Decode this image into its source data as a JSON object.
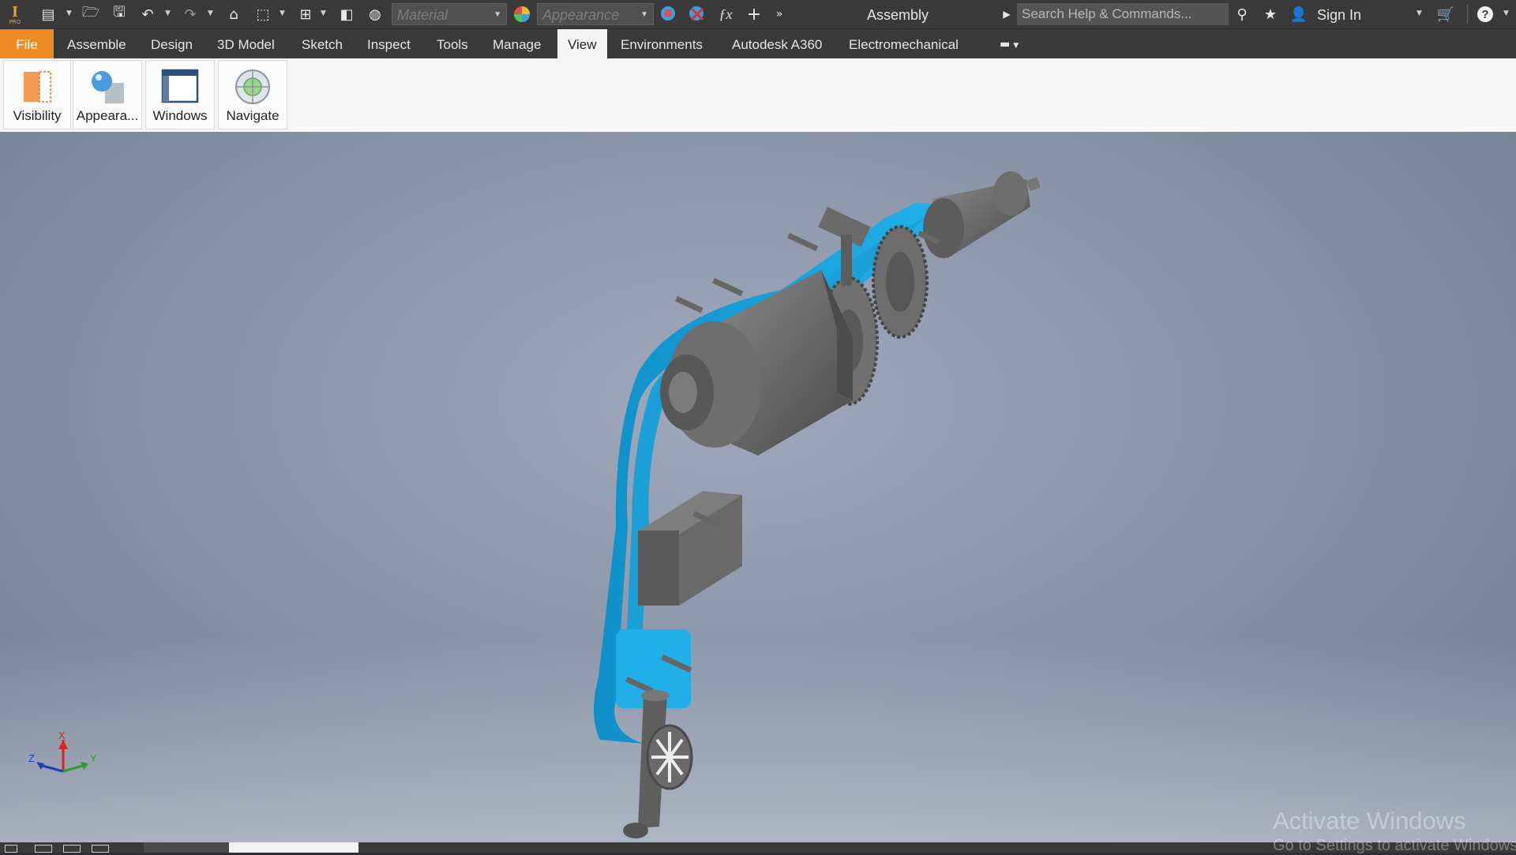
{
  "app": {
    "logo_text": "PRO",
    "doc_title": "Assembly"
  },
  "qat": {
    "material_placeholder": "Material",
    "appearance_placeholder": "Appearance",
    "search_placeholder": "Search Help & Commands...",
    "signin_label": "Sign In"
  },
  "tabs": [
    "File",
    "Assemble",
    "Design",
    "3D Model",
    "Sketch",
    "Inspect",
    "Tools",
    "Manage",
    "View",
    "Environments",
    "Autodesk A360",
    "Electromechanical"
  ],
  "active_tab": "View",
  "ribbon": {
    "buttons": [
      "Visibility",
      "Appeara...",
      "Windows",
      "Navigate"
    ]
  },
  "triad": {
    "x": "X",
    "y": "Y",
    "z": "Z"
  },
  "watermark": {
    "line1": "Activate Windows",
    "line2": "Go to Settings to activate Windows."
  },
  "colors": {
    "accent": "#f08a24",
    "housing": "#1aa3d9",
    "parts": "#6f6f6f"
  }
}
